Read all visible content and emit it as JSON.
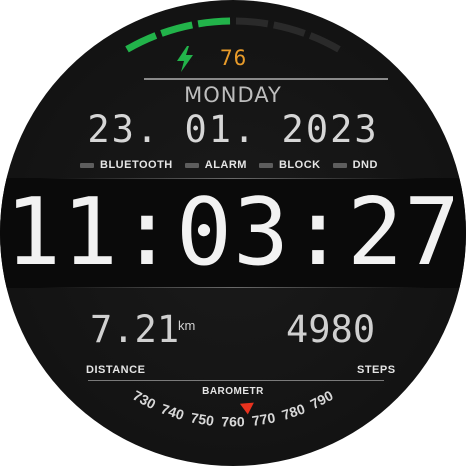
{
  "battery": {
    "value": "76",
    "level_fraction": 0.5,
    "segments": 6,
    "filled_segments": 3,
    "accent_color": "#22b34a",
    "empty_color": "#2a2a2a",
    "value_color": "#e89b2a",
    "icon": "lightning-bolt-icon"
  },
  "date": {
    "weekday": "MONDAY",
    "date_text": "23. 01. 2023"
  },
  "status": {
    "items": [
      {
        "label": "BLUETOOTH",
        "icon": "bluetooth-indicator"
      },
      {
        "label": "ALARM",
        "icon": "alarm-indicator"
      },
      {
        "label": "BLOCK",
        "icon": "block-indicator"
      },
      {
        "label": "DND",
        "icon": "dnd-indicator"
      }
    ]
  },
  "time": {
    "text": "11:03:27"
  },
  "distance": {
    "value": "7.21",
    "unit": "km",
    "label": "DISTANCE"
  },
  "steps": {
    "value": "4980",
    "label": "STEPS"
  },
  "barometer": {
    "label": "BAROMETR",
    "ticks": [
      "730",
      "740",
      "750",
      "760",
      "770",
      "780",
      "790"
    ],
    "pointer_value": 765,
    "pointer_color": "#e8321e"
  }
}
